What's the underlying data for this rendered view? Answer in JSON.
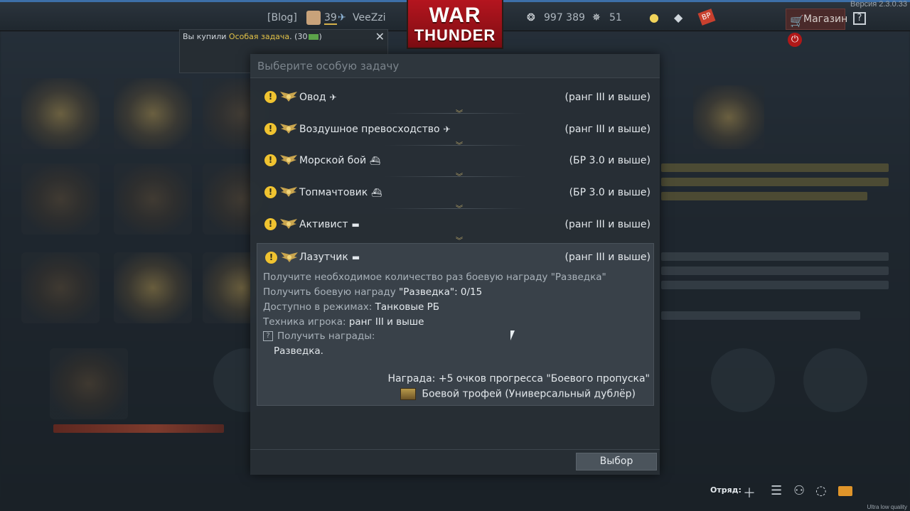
{
  "top_bar": {
    "version": "Версия 2.3.0.33",
    "blog": "[Blog]",
    "player_level": "39",
    "player_name": "VeeZzi",
    "silver_lions": "997 389",
    "golden_eagles": "51",
    "shop_label": "Магазин",
    "help_label": "?",
    "logo_line1": "WAR",
    "logo_line2": "THUNDER",
    "bp_label": "BP",
    "power_label": "⏻"
  },
  "notification": {
    "prefix": "Вы купили ",
    "item": "Особая задача",
    "suffix": ". (30",
    "suffix_end": ")",
    "close": "✕"
  },
  "dialog": {
    "title": "Выберите особую задачу",
    "tasks": [
      {
        "name": "Овод",
        "vehicle_icon": "plane-icon",
        "vehicle_glyph": "✈",
        "rank": "(ранг III и выше)"
      },
      {
        "name": "Воздушное превосходство",
        "vehicle_icon": "plane-icon",
        "vehicle_glyph": "✈",
        "rank": "(ранг III и выше)"
      },
      {
        "name": "Морской бой",
        "vehicle_icon": "ship-icon",
        "vehicle_glyph": "⛴",
        "rank": "(БР 3.0 и выше)"
      },
      {
        "name": "Топмачтовик",
        "vehicle_icon": "ship-icon",
        "vehicle_glyph": "⛴",
        "rank": "(БР 3.0 и выше)"
      },
      {
        "name": "Активист",
        "vehicle_icon": "tank-icon",
        "vehicle_glyph": "▬",
        "rank": "(ранг III и выше)"
      }
    ],
    "selected": {
      "name": "Лазутчик",
      "vehicle_icon": "tank-icon",
      "vehicle_glyph": "▬",
      "rank": "(ранг III и выше)",
      "description": "Получите необходимое количество раз боевую награду \"Разведка\"",
      "progress_label": "Получить боевую награду ",
      "progress_award": "\"Разведка\"",
      "progress_value": ": 0/15",
      "modes_label": "Доступно в режимах: ",
      "modes_value": "Танковые РБ",
      "vehicles_label": "Техника игрока: ",
      "vehicles_value": "ранг III и выше",
      "get_awards_label": "Получить награды:",
      "award_item": "Разведка.",
      "reward_text": "Награда: +5 очков прогресса \"Боевого пропуска\"",
      "trophy_text": "Боевой трофей (Универсальный дублёр)"
    },
    "choose_button": "Выбор"
  },
  "bottom_bar": {
    "squad_label": "Отряд:",
    "quality": "Ultra low quality"
  }
}
